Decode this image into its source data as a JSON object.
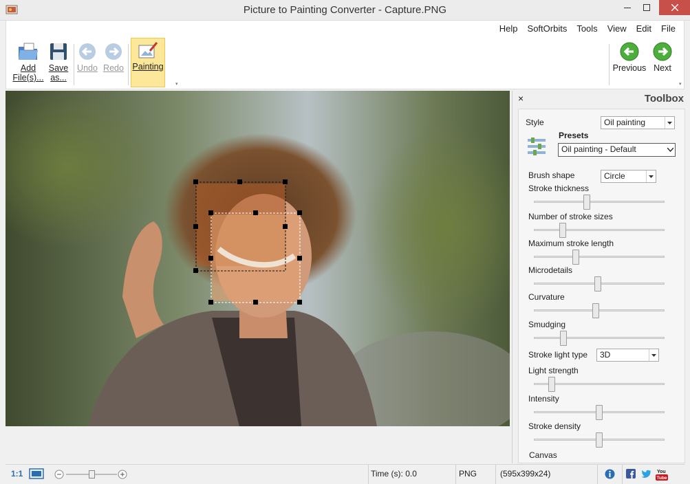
{
  "window": {
    "title": "Picture to Painting Converter - Capture.PNG"
  },
  "menu": [
    "Help",
    "SoftOrbits",
    "Tools",
    "View",
    "Edit",
    "File"
  ],
  "toolbar": {
    "add_files": "Add\nFile(s)...",
    "save_as": "Save\nas...",
    "undo": "Undo",
    "redo": "Redo",
    "painting": "Painting",
    "previous": "Previous",
    "next": "Next"
  },
  "toolbox": {
    "title": "Toolbox",
    "close_glyph": "×",
    "style_label": "Style",
    "style_value": "Oil painting",
    "presets_label": "Presets",
    "preset_value": "Oil painting - Default",
    "brush_shape_label": "Brush shape",
    "brush_shape_value": "Circle",
    "sliders": [
      {
        "label": "Stroke thickness",
        "level": 0.4
      },
      {
        "label": "Number of stroke sizes",
        "level": 0.2
      },
      {
        "label": "Maximum stroke length",
        "level": 0.31
      },
      {
        "label": "Microdetails",
        "level": 0.49
      },
      {
        "label": "Curvature",
        "level": 0.47
      },
      {
        "label": "Smudging",
        "level": 0.21
      }
    ],
    "stroke_light_type_label": "Stroke light type",
    "stroke_light_type_value": "3D",
    "sliders2": [
      {
        "label": "Light strength",
        "level": 0.11
      },
      {
        "label": "Intensity",
        "level": 0.5
      },
      {
        "label": "Stroke density",
        "level": 0.5
      }
    ],
    "canvas_label": "Canvas"
  },
  "status": {
    "zoom_ratio": "1:1",
    "time": "Time (s): 0.0",
    "format": "PNG",
    "dimensions": "(595x399x24)",
    "zoom_level": 0.5
  },
  "colors": {
    "accent_active": "#fde89a",
    "nav_green": "#4caf3c",
    "close_red": "#c7504b"
  }
}
